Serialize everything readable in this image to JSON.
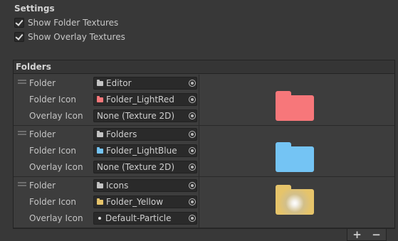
{
  "settings": {
    "title": "Settings",
    "show_folder_textures": "Show Folder Textures",
    "show_overlay_textures": "Show Overlay Textures"
  },
  "folders": {
    "title": "Folders",
    "labels": {
      "folder": "Folder",
      "folder_icon": "Folder Icon",
      "overlay_icon": "Overlay Icon"
    },
    "items": [
      {
        "folder": "Editor",
        "folder_icon": "Folder_LightRed",
        "overlay_icon": "None (Texture 2D)",
        "color": "#f7777a"
      },
      {
        "folder": "Folders",
        "folder_icon": "Folder_LightBlue",
        "overlay_icon": "None (Texture 2D)",
        "color": "#74c4f4"
      },
      {
        "folder": "Icons",
        "folder_icon": "Folder_Yellow",
        "overlay_icon": "Default-Particle",
        "color": "#e6c46a"
      }
    ]
  },
  "list_controls": {
    "add": "+",
    "remove": "−"
  },
  "icons": {
    "checkbox": "check-icon",
    "object_picker": "object-picker-icon",
    "folder": "folder-icon",
    "drag_handle": "drag-handle-icon"
  }
}
